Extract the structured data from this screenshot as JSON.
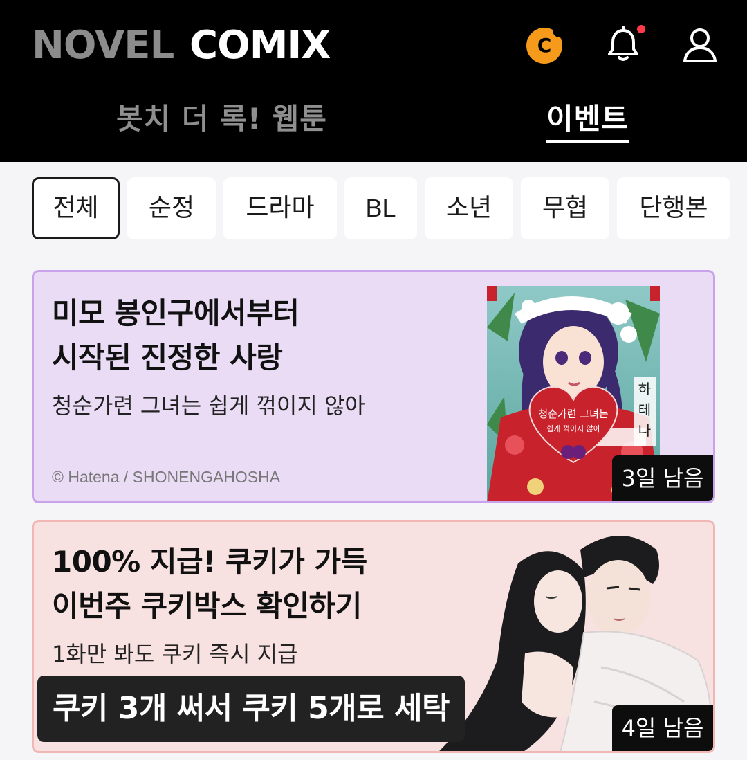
{
  "header": {
    "brand_novel": "NOVEL",
    "brand_comix": "COMIX",
    "coin_letter": "C",
    "tabs": [
      {
        "label": "봇치 더 록! 웹툰",
        "active": false
      },
      {
        "label": "이벤트",
        "active": true
      }
    ]
  },
  "filters": [
    {
      "label": "전체",
      "active": true
    },
    {
      "label": "순정"
    },
    {
      "label": "드라마"
    },
    {
      "label": "BL"
    },
    {
      "label": "소년"
    },
    {
      "label": "무협"
    },
    {
      "label": "단행본"
    }
  ],
  "events": [
    {
      "title_line1": "미모 봉인구에서부터",
      "title_line2": "시작된 진정한 사랑",
      "subtitle": "청순가련 그녀는 쉽게 꺾이지 않아",
      "credit": "© Hatena / SHONENGAHOSHA",
      "days_left": "3일 남음",
      "cover_title": "청순가련 그녀는",
      "cover_subtitle": "쉽게 꺾이지 않아",
      "cover_author_vertical": "하테나"
    },
    {
      "title_line1": "100% 지급! 쿠키가 가득",
      "title_line2": "이번주 쿠키박스 확인하기",
      "subtitle": "1화만 봐도 쿠키 즉시 지급",
      "banner": "쿠키 3개 써서 쿠키 5개로 세탁",
      "days_left": "4일 남음"
    }
  ],
  "colors": {
    "header_bg": "#000000",
    "page_bg": "#f5f5f7",
    "card1_bg": "#eadcf5",
    "card1_border": "#c9a2ec",
    "card2_bg": "#f8e1e1",
    "card2_border": "#f1b7b5",
    "coin": "#f59a1a",
    "notification_dot": "#ff3b48"
  },
  "icons": {
    "coin": "cookie-coin-icon",
    "bell": "bell-icon",
    "user": "user-icon"
  }
}
